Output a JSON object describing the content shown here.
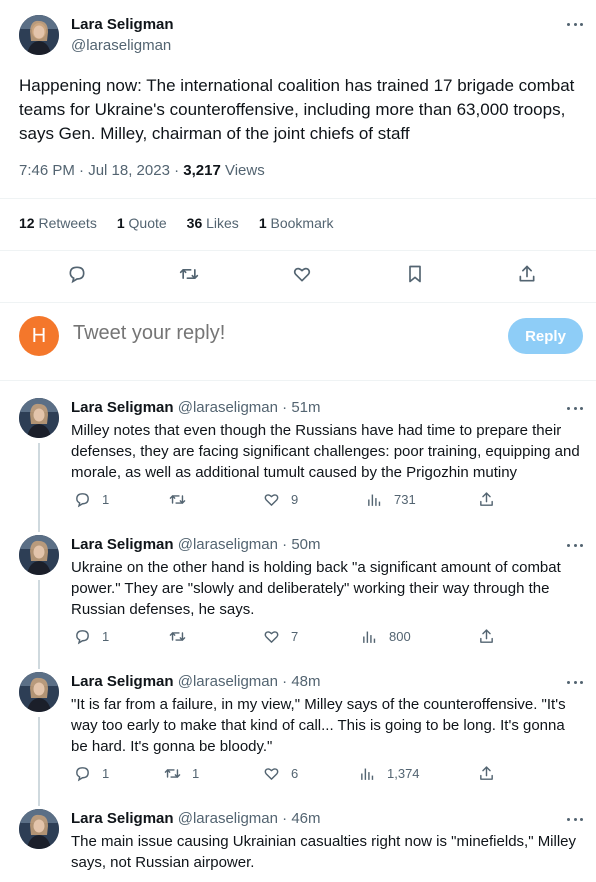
{
  "main_tweet": {
    "author_name": "Lara Seligman",
    "author_handle": "@laraseligman",
    "text": "Happening now: The international coalition has trained 17 brigade combat teams for Ukraine's counteroffensive, including more than 63,000 troops, says Gen. Milley, chairman of the joint chiefs of staff",
    "time": "7:46 PM · Jul 18, 2023 · ",
    "views_count": "3,217",
    "views_label": " Views",
    "stats": {
      "retweets_count": "12",
      "retweets_label": " Retweets",
      "quotes_count": "1",
      "quotes_label": " Quote",
      "likes_count": "36",
      "likes_label": " Likes",
      "bookmarks_count": "1",
      "bookmarks_label": " Bookmark"
    }
  },
  "reply_box": {
    "avatar_letter": "H",
    "placeholder": "Tweet your reply!",
    "button_label": "Reply"
  },
  "colors": {
    "accent": "#1d9bf0",
    "reply_button": "#8ecdf7",
    "reply_avatar": "#f4772b",
    "muted": "#536471"
  },
  "thread": [
    {
      "name": "Lara Seligman",
      "handle": "@laraseligman · 51m",
      "text": "Milley notes that even though the Russians have had time to prepare their defenses, they are facing significant challenges: poor training, equipping and morale, as well as additional tumult caused by the Prigozhin mutiny",
      "replies": "1",
      "retweets": "",
      "likes": "9",
      "views": "731"
    },
    {
      "name": "Lara Seligman",
      "handle": "@laraseligman · 50m",
      "text": "Ukraine on the other hand is holding back \"a significant amount of combat power.\" They are \"slowly and deliberately\" working their way through the Russian defenses, he says.",
      "replies": "1",
      "retweets": "",
      "likes": "7",
      "views": "800"
    },
    {
      "name": "Lara Seligman",
      "handle": "@laraseligman · 48m",
      "text": "\"It is far from a failure, in my view,\" Milley says of the counteroffensive. \"It's way too early to make that kind of call... This is going to be long. It's gonna be hard. It's gonna be bloody.\"",
      "replies": "1",
      "retweets": "1",
      "likes": "6",
      "views": "1,374"
    },
    {
      "name": "Lara Seligman",
      "handle": "@laraseligman · 46m",
      "text": "The main issue causing Ukrainian casualties right now is \"minefields,\" Milley says, not Russian airpower."
    }
  ]
}
